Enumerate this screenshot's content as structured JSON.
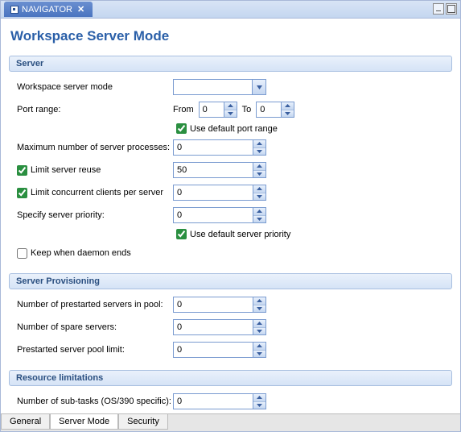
{
  "tab": {
    "label": "NAVIGATOR"
  },
  "page_title": "Workspace Server Mode",
  "sections": {
    "server": {
      "header": "Server",
      "workspace_mode_label": "Workspace server mode",
      "workspace_mode_value": "",
      "port_range_label": "Port range:",
      "port_from_label": "From",
      "port_from_value": "0",
      "port_to_label": "To",
      "port_to_value": "0",
      "use_default_port_label": "Use default port range",
      "use_default_port_checked": true,
      "max_processes_label": "Maximum number of server processes:",
      "max_processes_value": "0",
      "limit_reuse_label": "Limit server reuse",
      "limit_reuse_checked": true,
      "limit_reuse_value": "50",
      "limit_clients_label": "Limit concurrent clients per server",
      "limit_clients_checked": true,
      "limit_clients_value": "0",
      "priority_label": "Specify server priority:",
      "priority_value": "0",
      "use_default_priority_label": "Use  default server priority",
      "use_default_priority_checked": true,
      "keep_daemon_label": "Keep when daemon ends",
      "keep_daemon_checked": false
    },
    "provisioning": {
      "header": "Server Provisioning",
      "prestarted_label": "Number of prestarted servers in pool:",
      "prestarted_value": "0",
      "spare_label": "Number of spare servers:",
      "spare_value": "0",
      "pool_limit_label": "Prestarted server pool limit:",
      "pool_limit_value": "0"
    },
    "resource": {
      "header": "Resource limitations",
      "subtasks_label": "Number of sub-tasks (OS/390 specific):",
      "subtasks_value": "0"
    }
  },
  "bottom_tabs": {
    "general": "General",
    "server_mode": "Server Mode",
    "security": "Security",
    "active": "server_mode"
  }
}
